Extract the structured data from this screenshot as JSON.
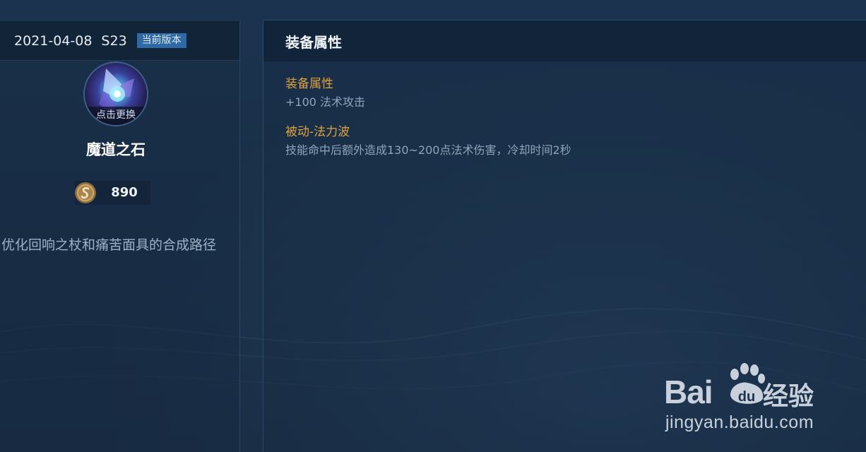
{
  "version_bar": {
    "date": "2021-04-08",
    "season": "S23",
    "badge": "当前版本"
  },
  "item": {
    "avatar_label": "点击更换",
    "name": "魔道之石",
    "price": "890",
    "currency_icon": "gold-coin-icon",
    "description": "优化回响之杖和痛苦面具的合成路径"
  },
  "attributes_panel": {
    "title": "装备属性",
    "sections": [
      {
        "title": "装备属性",
        "text": "+100 法术攻击"
      },
      {
        "title": "被动-法力波",
        "text": "技能命中后额外造成130~200点法术伤害，冷却时间2秒"
      }
    ]
  },
  "watermark": {
    "brand_left": "Bai",
    "brand_du": "du",
    "brand_right": "经验",
    "url": "jingyan.baidu.com"
  },
  "colors": {
    "accent_gold": "#e0a33b",
    "badge_blue": "#2f6aa6",
    "muted_text": "#8fa4bb"
  }
}
